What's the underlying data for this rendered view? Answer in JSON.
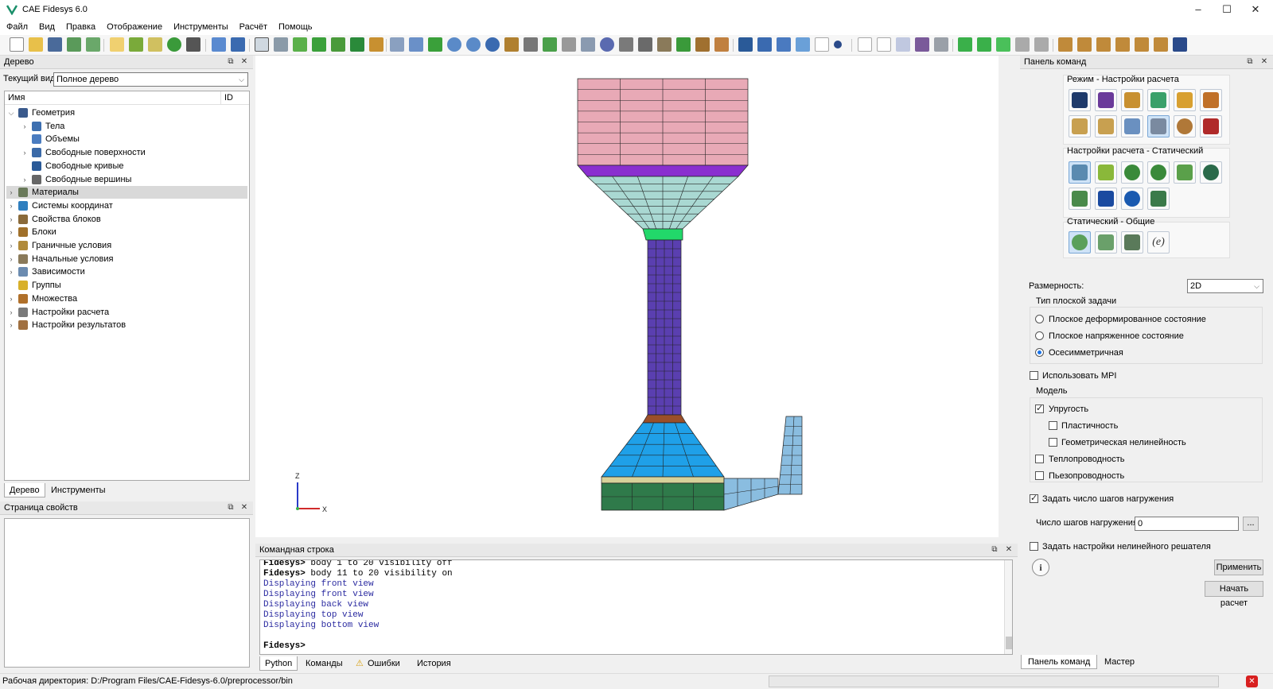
{
  "window": {
    "title": "CAE Fidesys 6.0",
    "minimize": "–",
    "maximize": "☐",
    "close": "✕"
  },
  "menu": [
    "Файл",
    "Вид",
    "Правка",
    "Отображение",
    "Инструменты",
    "Расчёт",
    "Помощь"
  ],
  "tree_panel": {
    "title": "Дерево",
    "current_view_label": "Текущий вид",
    "current_view_value": "Полное дерево",
    "col_name": "Имя",
    "col_id": "ID",
    "items": [
      {
        "label": "Геометрия",
        "level": 0,
        "expanded": true,
        "icon": "geometry-icon",
        "color": "#3a5a8c"
      },
      {
        "label": "Тела",
        "level": 1,
        "expanded": false,
        "icon": "body-icon",
        "color": "#3d6fb0"
      },
      {
        "label": "Объемы",
        "level": 1,
        "leaf": true,
        "icon": "volume-icon",
        "color": "#4a7cc0"
      },
      {
        "label": "Свободные поверхности",
        "level": 1,
        "expanded": false,
        "icon": "surface-icon",
        "color": "#3b6aa8"
      },
      {
        "label": "Свободные кривые",
        "level": 1,
        "leaf": true,
        "icon": "curve-icon",
        "color": "#2a5a98"
      },
      {
        "label": "Свободные вершины",
        "level": 1,
        "expanded": false,
        "icon": "vertex-icon",
        "color": "#666666"
      },
      {
        "label": "Материалы",
        "level": 0,
        "expanded": false,
        "icon": "materials-icon",
        "color": "#6a7a5a",
        "selected": true
      },
      {
        "label": "Системы координат",
        "level": 0,
        "expanded": false,
        "icon": "coordinate-system-icon",
        "color": "#2f7fbf"
      },
      {
        "label": "Свойства блоков",
        "level": 0,
        "expanded": false,
        "icon": "block-properties-icon",
        "color": "#8a6a3a"
      },
      {
        "label": "Блоки",
        "level": 0,
        "expanded": false,
        "icon": "blocks-icon",
        "color": "#a0702a"
      },
      {
        "label": "Граничные условия",
        "level": 0,
        "expanded": false,
        "icon": "boundary-conditions-icon",
        "color": "#b08a3a"
      },
      {
        "label": "Начальные условия",
        "level": 0,
        "expanded": false,
        "icon": "initial-conditions-icon",
        "color": "#8a7a5a"
      },
      {
        "label": "Зависимости",
        "level": 0,
        "expanded": false,
        "icon": "dependencies-icon",
        "color": "#6b8bb0"
      },
      {
        "label": "Группы",
        "level": 0,
        "leaf": true,
        "icon": "groups-icon",
        "color": "#d8b02a"
      },
      {
        "label": "Множества",
        "level": 0,
        "expanded": false,
        "icon": "sets-icon",
        "color": "#b0702a"
      },
      {
        "label": "Настройки расчета",
        "level": 0,
        "expanded": false,
        "icon": "calc-settings-icon",
        "color": "#7a7a7a"
      },
      {
        "label": "Настройки результатов",
        "level": 0,
        "expanded": false,
        "icon": "results-settings-icon",
        "color": "#a07040"
      }
    ],
    "tabs": [
      "Дерево",
      "Инструменты"
    ]
  },
  "props_panel": {
    "title": "Страница свойств"
  },
  "command_panel": {
    "title": "Командная строка",
    "lines": [
      {
        "prompt": "Fidesys>",
        "text": " body 1 to 20 visibility off",
        "kind": "cmd"
      },
      {
        "prompt": "Fidesys>",
        "text": " body 11 to 20 visibility on",
        "kind": "cmd"
      },
      {
        "text": "Displaying front view",
        "kind": "out"
      },
      {
        "text": "Displaying front view",
        "kind": "out"
      },
      {
        "text": "Displaying back view",
        "kind": "out"
      },
      {
        "text": "Displaying top view",
        "kind": "out"
      },
      {
        "text": "Displaying bottom view",
        "kind": "out"
      }
    ],
    "prompt": "Fidesys>",
    "tabs": [
      "Python",
      "Команды",
      "Ошибки",
      "История"
    ]
  },
  "axes": {
    "z": "Z",
    "x": "X"
  },
  "right_panel": {
    "title": "Панель команд",
    "mode_title": "Режим - Настройки расчета",
    "static_title": "Настройки расчета - Статический",
    "general_title": "Статический - Общие",
    "dimension_label": "Размерность:",
    "dimension_value": "2D",
    "plane_group": "Тип плоской задачи",
    "radios": [
      {
        "label": "Плоское деформированное состояние",
        "checked": false
      },
      {
        "label": "Плоское напряженное состояние",
        "checked": false
      },
      {
        "label": "Осесимметричная",
        "checked": true
      }
    ],
    "use_mpi": "Использовать MPI",
    "model_group": "Модель",
    "model_checks": [
      {
        "label": "Упругость",
        "checked": true,
        "indent": 0
      },
      {
        "label": "Пластичность",
        "checked": false,
        "indent": 1
      },
      {
        "label": "Геометрическая нелинейность",
        "checked": false,
        "indent": 1
      },
      {
        "label": "Теплопроводность",
        "checked": false,
        "indent": 0
      },
      {
        "label": "Пьезопроводность",
        "checked": false,
        "indent": 0
      }
    ],
    "set_steps": "Задать число шагов нагружения",
    "steps_label": "Число шагов нагружения",
    "steps_value": "0",
    "steps_more": "...",
    "nonlinear": "Задать настройки нелинейного решателя",
    "apply": "Применить",
    "start": "Начать расчет",
    "tabs": [
      "Панель команд",
      "Мастер"
    ]
  },
  "status": {
    "workdir": "Рабочая директория: D:/Program Files/CAE-Fidesys-6.0/preprocessor/bin"
  },
  "colors": {
    "pink": "#e8a9b6",
    "purple": "#8a2fcf",
    "teal": "#a9d8d2",
    "green": "#22d86a",
    "indigo": "#5a3fb0",
    "brown": "#9a4f2a",
    "blue": "#1fa0e8",
    "beige": "#d8d29a",
    "darkgreen": "#2f7a4a",
    "lightblue": "#8abde0"
  }
}
